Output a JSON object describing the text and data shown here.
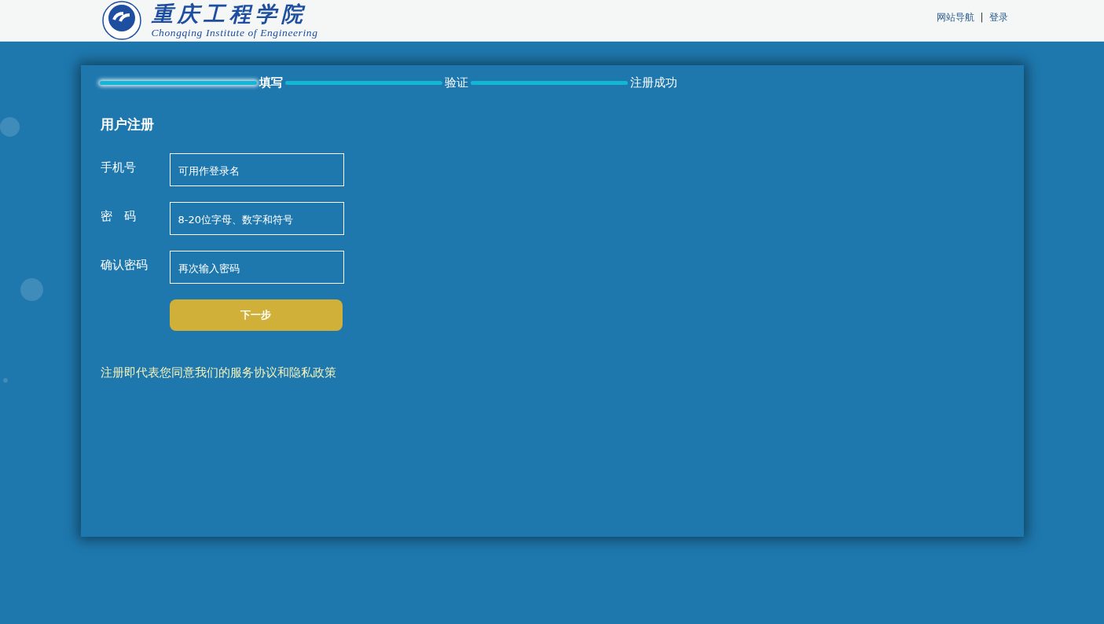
{
  "header": {
    "logo": {
      "name_cn": "重庆工程学院",
      "name_en": "Chongqing Institute of Engineering"
    },
    "links": [
      "网站导航",
      "登录"
    ],
    "separator": "|"
  },
  "steps": [
    {
      "label": "填写",
      "selected": true
    },
    {
      "label": "验证",
      "selected": false
    },
    {
      "label": "注册成功",
      "selected": false
    }
  ],
  "form": {
    "title": "用户注册",
    "fields": [
      {
        "label": "手机号",
        "placeholder": "可用作登录名"
      },
      {
        "label": "密　码",
        "placeholder": "8-20位字母、数字和符号"
      },
      {
        "label": "确认密码",
        "placeholder": "再次输入密码"
      }
    ],
    "submit": "下一步",
    "agreement": "注册即代表您同意我们的服务协议和隐私政策"
  }
}
